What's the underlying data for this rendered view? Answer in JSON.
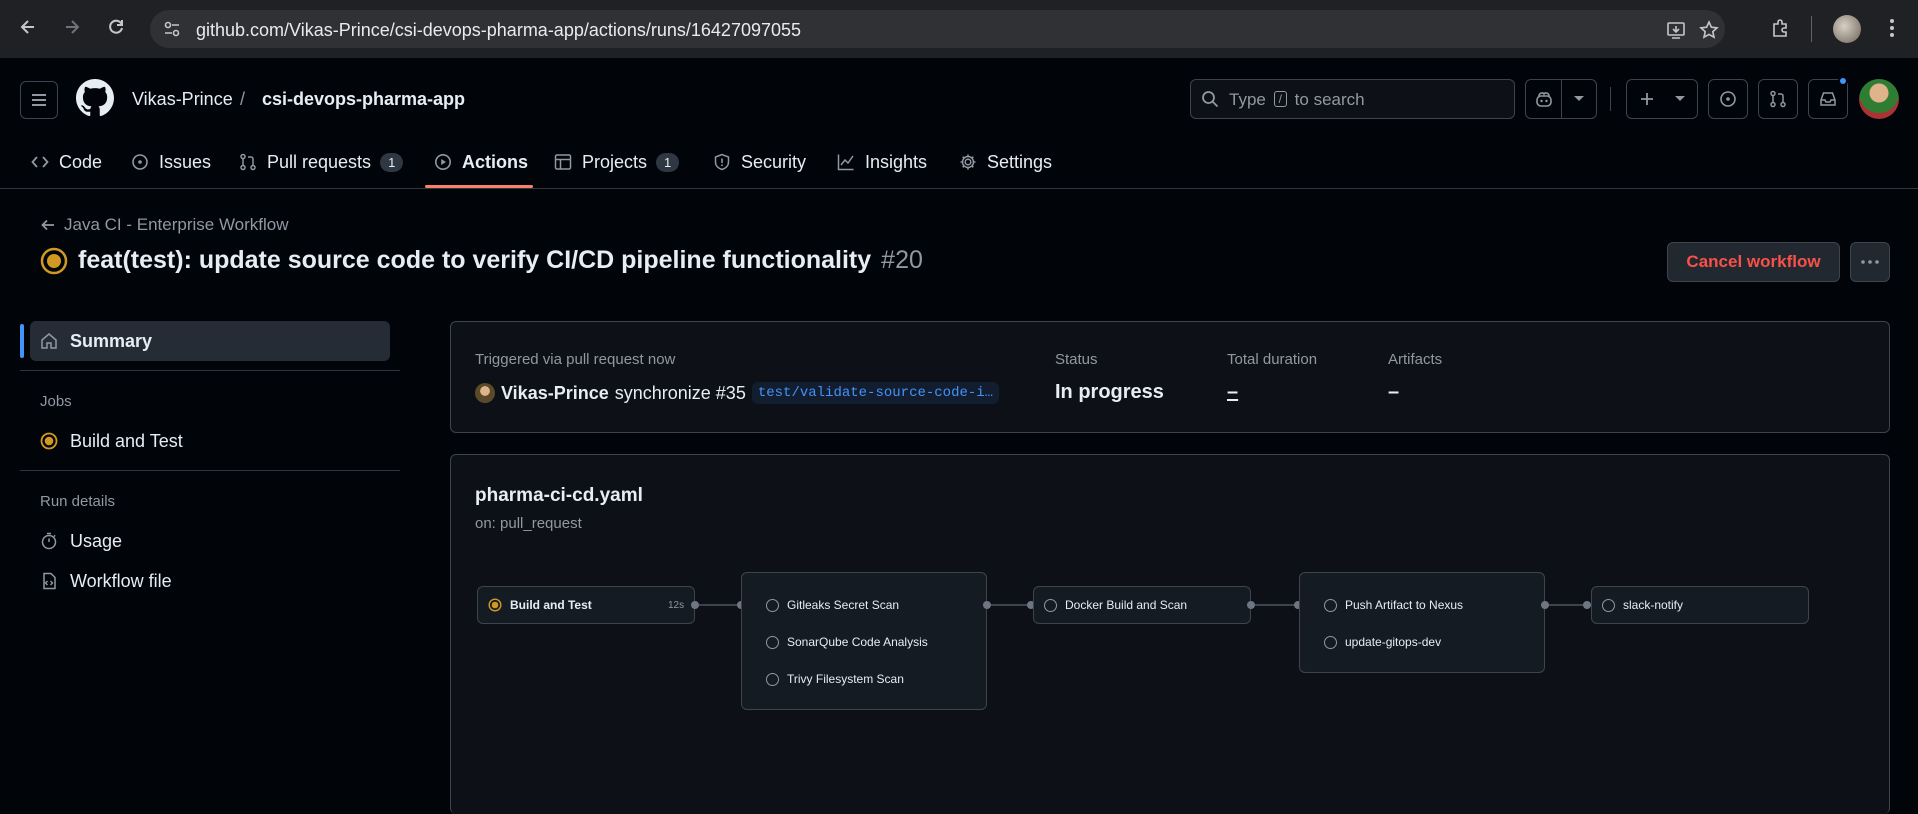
{
  "browser": {
    "url": "github.com/Vikas-Prince/csi-devops-pharma-app/actions/runs/16427097055"
  },
  "header": {
    "owner": "Vikas-Prince",
    "separator": "/",
    "repo": "csi-devops-pharma-app",
    "search_placeholder_pre": "Type",
    "search_key": "/",
    "search_placeholder_post": "to search"
  },
  "tabs": [
    {
      "label": "Code",
      "icon": "code-icon"
    },
    {
      "label": "Issues",
      "icon": "issue-opened-icon"
    },
    {
      "label": "Pull requests",
      "icon": "git-pull-request-icon",
      "counter": "1"
    },
    {
      "label": "Actions",
      "icon": "play-icon",
      "selected": true
    },
    {
      "label": "Projects",
      "icon": "table-icon",
      "counter": "1"
    },
    {
      "label": "Security",
      "icon": "shield-icon"
    },
    {
      "label": "Insights",
      "icon": "graph-icon"
    },
    {
      "label": "Settings",
      "icon": "gear-icon"
    }
  ],
  "run": {
    "workflow_name": "Java CI - Enterprise Workflow",
    "title": "feat(test): update source code to verify CI/CD pipeline functionality",
    "number": "#20",
    "cancel_label": "Cancel workflow"
  },
  "sidebar": {
    "summary": "Summary",
    "jobs_heading": "Jobs",
    "jobs": [
      "Build and Test"
    ],
    "run_details_heading": "Run details",
    "usage": "Usage",
    "workflow_file": "Workflow file"
  },
  "summary": {
    "trigger": "Triggered via pull request now",
    "actor": "Vikas-Prince",
    "event": "synchronize #35",
    "branch": "test/validate-source-code-i…",
    "status_label": "Status",
    "status_value": "In progress",
    "duration_label": "Total duration",
    "duration_value": "–",
    "artifacts_label": "Artifacts",
    "artifacts_value": "–"
  },
  "workflow": {
    "file": "pharma-ci-cd.yaml",
    "on": "on: pull_request",
    "jobs": {
      "build": {
        "name": "Build and Test",
        "duration": "12s"
      },
      "scan_group": [
        "Gitleaks Secret Scan",
        "SonarQube Code Analysis",
        "Trivy Filesystem Scan"
      ],
      "docker": "Docker Build and Scan",
      "publish_group": [
        "Push Artifact to Nexus",
        "update-gitops-dev"
      ],
      "notify": "slack-notify"
    }
  },
  "colors": {
    "accent_blue": "#4493f8",
    "in_progress_yellow": "#d29922",
    "danger_red": "#f85149",
    "tab_underline": "#f78166"
  }
}
